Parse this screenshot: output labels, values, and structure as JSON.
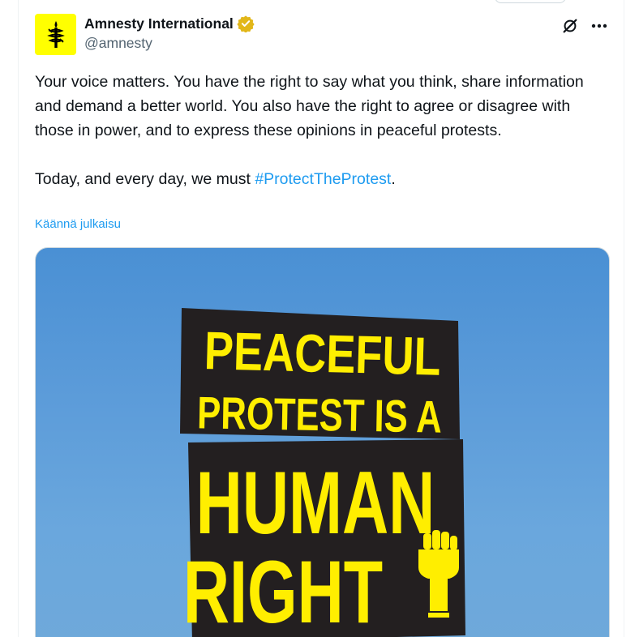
{
  "tweet": {
    "author": {
      "display_name": "Amnesty International",
      "handle": "@amnesty",
      "avatar_icon": "amnesty-candle-logo",
      "avatar_bg": "#ffff00",
      "verified_badge": "gold-verified-icon"
    },
    "actions": {
      "grok_icon": "grok-icon",
      "more_icon": "more-icon",
      "more_label": "···"
    },
    "text": {
      "paragraph1": "Your voice matters. You have the right to say what you think, share information and demand a better world. You also have the right to agree or disagree with those in power, and to express these opinions in peaceful protests.",
      "paragraph2_before": "Today, and every day, we must ",
      "hashtag": "#ProtectTheProtest",
      "paragraph2_after": "."
    },
    "translate_label": "Käännä julkaisu",
    "media": {
      "poster_lines": [
        "PEACEFUL",
        "PROTEST IS A",
        "HUMAN",
        "RIGHT"
      ],
      "fist_icon": "raised-fist-icon",
      "poster_text_color": "#ffee00",
      "poster_block_color": "#231f20",
      "sky_color": "#5b9bd9"
    }
  }
}
